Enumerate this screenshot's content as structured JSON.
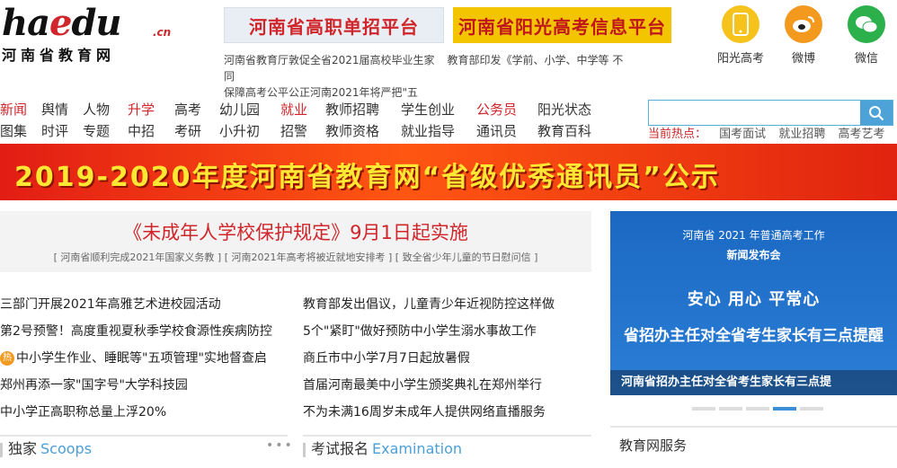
{
  "header": {
    "logo_word_pre": "ha",
    "logo_word_e": "e",
    "logo_word_post": "du",
    "logo_cn": ".cn",
    "logo_sub": "河南省教育网",
    "banner1": "河南省高职单招平台",
    "banner2": "河南省阳光高考信息平台",
    "ticker": [
      "河南省教育厅敦促全省2021届高校毕业生家",
      "教育部印发《学前、小学、中学等 不同",
      "保障高考公平公正河南2021年将严把\"五"
    ],
    "social": [
      {
        "label": "阳光高考",
        "icon": "phone-icon",
        "color": "#f6c21c"
      },
      {
        "label": "微博",
        "icon": "weibo-icon",
        "color": "#f39a1e"
      },
      {
        "label": "微信",
        "icon": "wechat-icon",
        "color": "#2bb04b"
      }
    ]
  },
  "nav": {
    "row1": [
      {
        "label": "新闻",
        "hot": true
      },
      {
        "label": "舆情",
        "hot": false
      },
      {
        "label": "人物",
        "hot": false
      },
      {
        "label": "升学",
        "hot": true
      },
      {
        "label": "高考",
        "hot": false
      },
      {
        "label": "幼儿园",
        "hot": false
      },
      {
        "label": "就业",
        "hot": true
      },
      {
        "label": "教师招聘",
        "hot": false
      },
      {
        "label": "学生创业",
        "hot": false
      },
      {
        "label": "公务员",
        "hot": true
      },
      {
        "label": "阳光状态",
        "hot": false
      }
    ],
    "row2": [
      {
        "label": "图集"
      },
      {
        "label": "时评"
      },
      {
        "label": "专题"
      },
      {
        "label": "中招"
      },
      {
        "label": "考研"
      },
      {
        "label": "小升初"
      },
      {
        "label": "招警"
      },
      {
        "label": "教师资格"
      },
      {
        "label": "就业指导"
      },
      {
        "label": "通讯员"
      },
      {
        "label": "教育百科"
      }
    ]
  },
  "search": {
    "placeholder": "",
    "hot_label": "当前热点：",
    "hot_words": [
      "国考面试",
      "就业招聘",
      "高考艺考"
    ]
  },
  "big_banner": "2019-2020年度河南省教育网“省级优秀通讯员”公示",
  "headline": {
    "title": "《未成年人学校保护规定》9月1日起实施",
    "subs": [
      "[ 河南省顺利完成2021年国家义务教 ]",
      "[ 河南2021年高考将被近就地安排考 ]",
      "[ 致全省少年儿童的节日慰问信 ]"
    ]
  },
  "news_left": [
    "三部门开展2021年高雅艺术进校园活动",
    "第2号预警！高度重视夏秋季学校食源性疾病防控",
    "中小学生作业、睡眠等\"五项管理\"实地督查启",
    "郑州再添一家\"国字号\"大学科技园",
    "中小学正高职称总量上浮20%"
  ],
  "news_left_badge": "热",
  "news_right": [
    "教育部发出倡议，儿童青少年近视防控这样做",
    "5个\"紧盯\"做好预防中小学生溺水事故工作",
    "商丘市中小学7月7日起放暑假",
    "首届河南最美中小学生颁奖典礼在郑州举行",
    "不为未满16周岁未成年人提供网络直播服务"
  ],
  "sections": {
    "scoops_cn": "独家",
    "scoops_en": "Scoops",
    "exam_cn": "考试报名",
    "exam_en": "Examination",
    "more": "•••",
    "service": "教育网服务"
  },
  "promo": {
    "line1": "河南省 2021 年普通高考工作",
    "line2": "新闻发布会",
    "line3": "安心 用心 平常心",
    "line4": "省招办主任对全省考生家长有三点提醒",
    "caption": "河南省招办主任对全省考生家长有三点提",
    "pages": 5,
    "active_page": 4
  }
}
